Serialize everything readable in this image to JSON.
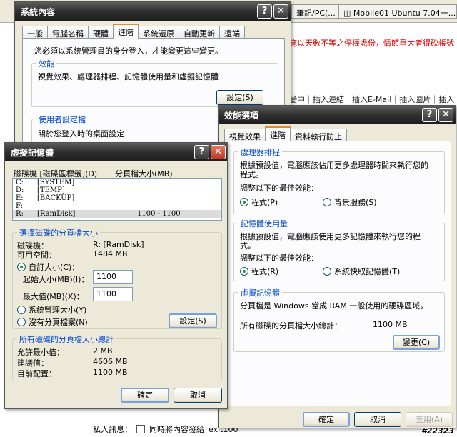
{
  "browser": {
    "tab1": "筆記/PC(...",
    "tab2": "Mobile01 Ubuntu 7.04一...",
    "red_notice": "施以天數不等之停權處份，情節重大者得砍帳號",
    "toolbar": "變中｜插入連結｜插入E-Mail｜插入圖片｜插入",
    "bottom_label": "私人訊息：",
    "bottom_checkbox": "同時將內容發給",
    "bottom_suffix": "exit100"
  },
  "watermark": "#22323",
  "sysprop": {
    "title": "系統內容",
    "tabs": [
      "一般",
      "電腦名稱",
      "硬體",
      "進階",
      "系統還原",
      "自動更新",
      "遠端"
    ],
    "admin_note": "您必須以系統管理員的身分登入，才能變更這些變更。",
    "perf_label": "效能",
    "perf_desc": "視覺效果、處理器排程、記憶體使用量和虛擬記憶體",
    "settings_btn": "設定(S)",
    "profile_label": "使用者設定檔",
    "profile_desc": "關於您登入時的桌面設定"
  },
  "perf": {
    "title": "效能選項",
    "tabs": [
      "視覺效果",
      "進階",
      "資料執行防止"
    ],
    "cpu_label": "處理器排程",
    "cpu_desc1": "根據預設值，電腦應該佔用更多處理器時間來執行您的",
    "cpu_desc2": "程式。",
    "cpu_adjust": "調整以下的最佳效能：",
    "cpu_opt1": "程式(P)",
    "cpu_opt2": "背景服務(S)",
    "mem_label": "記憶體使用量",
    "mem_desc1": "根據預設值，電腦應該使用更多記憶體來執行您的程",
    "mem_desc2": "式。",
    "mem_adjust": "調整以下的最佳效能：",
    "mem_opt1": "程式(R)",
    "mem_opt2": "系統快取記憶體(T)",
    "vm_label": "虛擬記憶體",
    "vm_desc": "分頁檔是 Windows 當成 RAM 一般使用的硬碟區域。",
    "vm_total_label": "所有磁碟的分頁檔大小總計：",
    "vm_total_value": "1100 MB",
    "change_btn": "變更(C)",
    "ok": "確定",
    "cancel": "取消",
    "apply": "套用(A)"
  },
  "vmem": {
    "title": "虛擬記憶體",
    "col_drive": "磁碟機 [磁碟區標籤](D)",
    "col_size": "分頁檔大小(MB)",
    "drives": [
      {
        "letter": "C:",
        "label": "[SYSTEM]",
        "size": ""
      },
      {
        "letter": "D:",
        "label": "[TEMP]",
        "size": ""
      },
      {
        "letter": "E:",
        "label": "[BACKUP]",
        "size": ""
      },
      {
        "letter": "F:",
        "label": "",
        "size": ""
      },
      {
        "letter": "R:",
        "label": "[RamDisk]",
        "size": "1100 - 1100"
      }
    ],
    "sel_label": "選擇磁碟的分頁檔大小",
    "drive_key": "磁碟機：",
    "drive_val": "R: [RamDisk]",
    "space_key": "可用空間：",
    "space_val": "1484 MB",
    "custom": "自訂大小(C)：",
    "init_label": "起始大小(MB)(I)：",
    "init_val": "1100",
    "max_label": "最大值(MB)(X)：",
    "max_val": "1100",
    "system_managed": "系統管理大小(Y)",
    "no_paging": "沒有分頁檔案(N)",
    "set_btn": "設定(S)",
    "total_label": "所有磁碟的分頁檔大小總計",
    "min_key": "允許最小值：",
    "min_val": "2 MB",
    "rec_key": "建議值：",
    "rec_val": "4606 MB",
    "cur_key": "目前配置：",
    "cur_val": "1100 MB",
    "ok": "確定",
    "cancel": "取消"
  }
}
